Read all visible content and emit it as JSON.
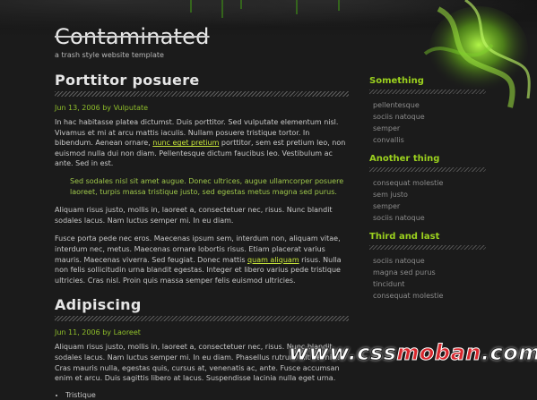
{
  "site": {
    "title": "Contaminated",
    "tagline": "a trash style website template"
  },
  "posts": [
    {
      "title": "Porttitor posuere",
      "meta": "Jun 13, 2006 by Vulputate",
      "p1_a": "In hac habitasse platea dictumst. Duis porttitor. Sed vulputate elementum nisl. Vivamus et mi at arcu mattis iaculis. Nullam posuere tristique tortor. In bibendum. Aenean ornare, ",
      "p1_link": "nunc eget pretium",
      "p1_b": " porttitor, sem est pretium leo, non euismod nulla dui non diam. Pellentesque dictum faucibus leo. Vestibulum ac ante. Sed in est.",
      "quote": "Sed sodales nisl sit amet augue. Donec ultrices, augue ullamcorper posuere laoreet, turpis massa tristique justo, sed egestas metus magna sed purus.",
      "p2": "Aliquam risus justo, mollis in, laoreet a, consectetuer nec, risus. Nunc blandit sodales lacus. Nam luctus semper mi. In eu diam.",
      "p3_a": "Fusce porta pede nec eros. Maecenas ipsum sem, interdum non, aliquam vitae, interdum nec, metus. Maecenas ornare lobortis risus. Etiam placerat varius mauris. Maecenas viverra. Sed feugiat. Donec mattis ",
      "p3_link": "quam aliquam",
      "p3_b": " risus. Nulla non felis sollicitudin urna blandit egestas. Integer et libero varius pede tristique ultricies. Cras nisl. Proin quis massa semper felis euismod ultricies."
    },
    {
      "title": "Adipiscing",
      "meta": "Jun 11, 2006 by Laoreet",
      "p1": "Aliquam risus justo, mollis in, laoreet a, consectetuer nec, risus. Nunc blandit sodales lacus. Nam luctus semper mi. In eu diam. Phasellus rutrum elit vel nisi. Cras mauris nulla, egestas quis, cursus at, venenatis ac, ante. Fusce accumsan enim et arcu. Duis sagittis libero at lacus. Suspendisse lacinia nulla eget urna.",
      "bullets": [
        "Tristique"
      ]
    }
  ],
  "sidebar": [
    {
      "title": "Something",
      "items": [
        "pellentesque",
        "sociis natoque",
        "semper",
        "convallis"
      ]
    },
    {
      "title": "Another thing",
      "items": [
        "consequat molestie",
        "sem justo",
        "semper",
        "sociis natoque"
      ]
    },
    {
      "title": "Third and last",
      "items": [
        "sociis natoque",
        "magna sed purus",
        "tincidunt",
        "consequat molestie"
      ]
    }
  ],
  "watermark": {
    "prefix": "www.css",
    "accent": "moban",
    "suffix": ".com"
  },
  "colors": {
    "accent_green": "#9bd11e",
    "link": "#c8e63a",
    "background": "#1b1b1b"
  }
}
